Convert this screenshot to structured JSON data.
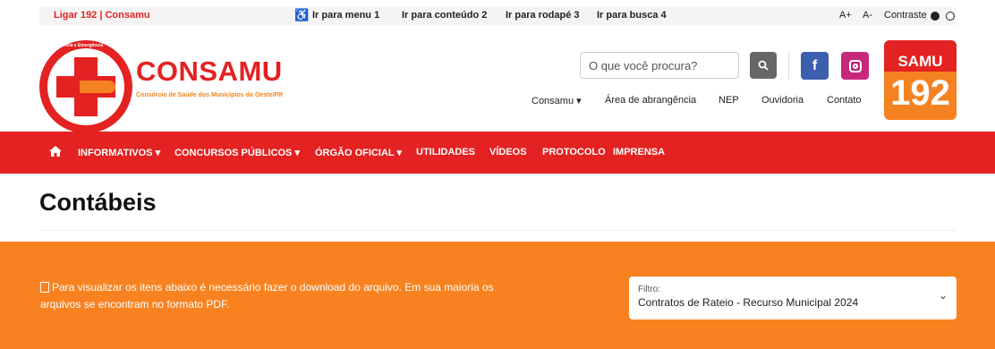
{
  "topbar": {
    "call_label": "Ligar 192 | Consamu",
    "skip_links": [
      "Ir para menu 1",
      "Ir para conteúdo 2",
      "Ir para rodapé 3",
      "Ir para busca 4"
    ],
    "font_increase": "A+",
    "font_decrease": "A-",
    "contrast_label": "Contraste"
  },
  "header": {
    "brand_name": "CONSAMU",
    "brand_subtitle": "Consórcio de Saúde dos Municípios do Oeste/PR",
    "logo_ring_text": "Urgência e Emergência",
    "search_placeholder": "O que você procura?",
    "social": {
      "facebook": "f"
    },
    "samu_label": "SAMU",
    "samu_number": "192",
    "subnav": [
      "Consamu ▾",
      "Área de abrangência",
      "NEP",
      "Ouvidoria",
      "Contato"
    ]
  },
  "main_nav": [
    "INFORMATIVOS ▾",
    "CONCURSOS PÚBLICOS ▾",
    "ÓRGÃO OFICIAL ▾",
    "UTILIDADES",
    "VÍDEOS",
    "PROTOCOLO",
    "IMPRENSA"
  ],
  "page": {
    "title": "Contábeis",
    "notice": "Para visualizar os itens abaixo é necessário fazer o download do arquivo. Em sua maioria os arquivos se encontram no formato PDF.",
    "filter_label": "Filtro:",
    "filter_value": "Contratos de Rateio - Recurso Municipal 2024"
  },
  "colors": {
    "brand_red": "#e32221",
    "brand_orange": "#f58220",
    "facebook": "#3b5fae",
    "instagram": "#c62979"
  }
}
